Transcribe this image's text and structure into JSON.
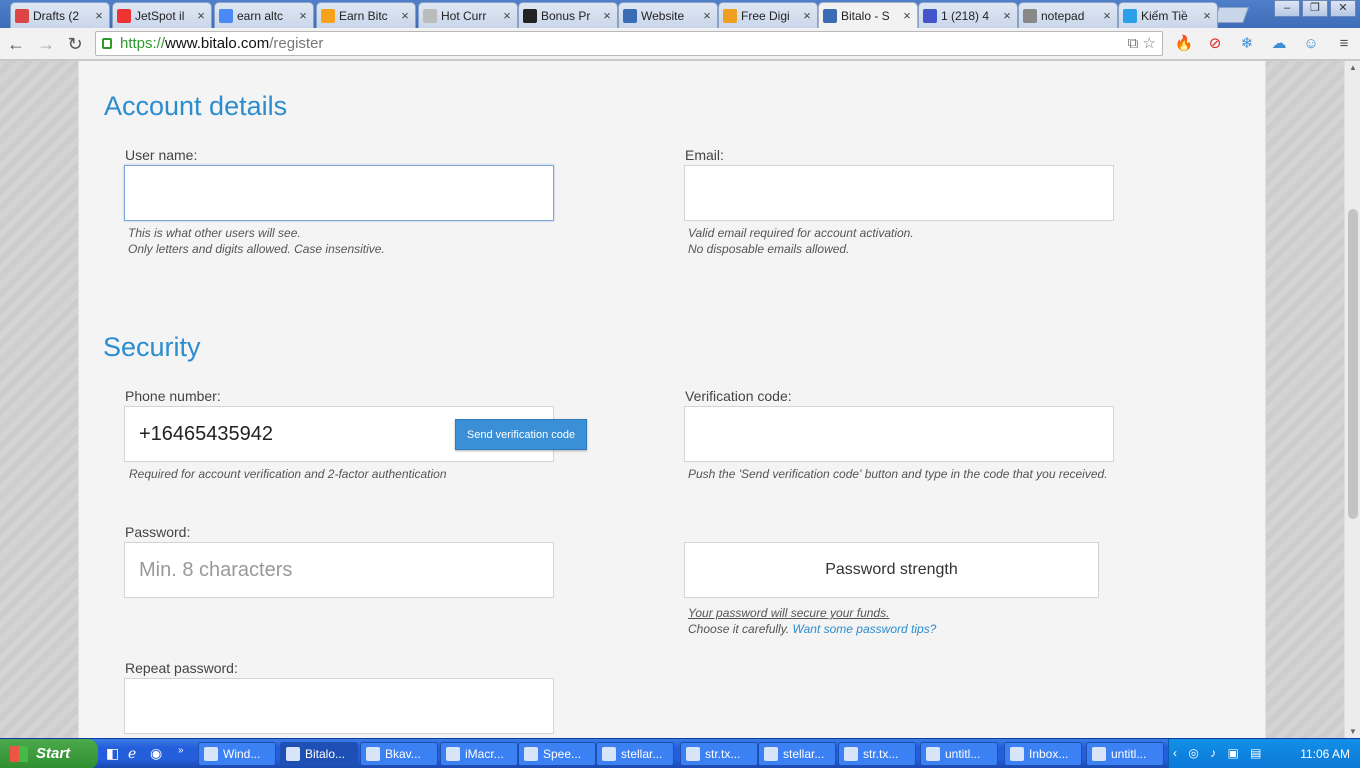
{
  "browser": {
    "tabs": [
      {
        "title": "Drafts (2",
        "icon": "gmail-icon",
        "color": "#d44"
      },
      {
        "title": "JetSpot il",
        "icon": "jetspot-icon",
        "color": "#e33"
      },
      {
        "title": "earn altc",
        "icon": "google-icon",
        "color": "#4a8af4"
      },
      {
        "title": "Earn Bitc",
        "icon": "bitcoin-icon",
        "color": "#f7a21a"
      },
      {
        "title": "Hot Curr",
        "icon": "page-icon",
        "color": "#bbb"
      },
      {
        "title": "Bonus Pr",
        "icon": "w-icon",
        "color": "#222"
      },
      {
        "title": "Website",
        "icon": "r-icon",
        "color": "#3a6db5"
      },
      {
        "title": "Free Digi",
        "icon": "coin-icon",
        "color": "#f0a020"
      },
      {
        "title": "Bitalo - S",
        "icon": "bitalo-icon",
        "color": "#3a6db5"
      },
      {
        "title": "1 (218) 4",
        "icon": "circle-icon",
        "color": "#4455cc"
      },
      {
        "title": "notepad",
        "icon": "notepad-icon",
        "color": "#888"
      },
      {
        "title": "Kiếm Tiề",
        "icon": "skype-icon",
        "color": "#2aa0e8"
      }
    ],
    "active_tab": 8,
    "url_scheme": "https://",
    "url_host": "www.bitalo.com",
    "url_path": "/register"
  },
  "form": {
    "account_heading": "Account details",
    "username_label": "User name:",
    "username_value": "",
    "username_hint1": "This is what other users will see.",
    "username_hint2": "Only letters and digits allowed. Case insensitive.",
    "email_label": "Email:",
    "email_value": "",
    "email_hint1": "Valid email required for account activation.",
    "email_hint2": "No disposable emails allowed.",
    "security_heading": "Security",
    "phone_label": "Phone number:",
    "phone_value": "+16465435942",
    "send_code_button": "Send verification code",
    "phone_hint": "Required for account verification and 2-factor authentication",
    "verify_label": "Verification code:",
    "verify_value": "",
    "verify_hint": "Push the 'Send verification code' button and type in the code that you received.",
    "password_label": "Password:",
    "password_placeholder": "Min. 8 characters",
    "strength_text": "Password strength",
    "strength_hint1": "Your password will secure your funds.",
    "strength_hint2": "Choose it carefully.",
    "strength_link": "Want some password tips?",
    "repeat_label": "Repeat password:"
  },
  "taskbar": {
    "start_label": "Start",
    "tasks": [
      "Wind...",
      "Bitalo...",
      "Bkav...",
      "iMacr...",
      "Spee...",
      "stellar...",
      "str.tx...",
      "stellar...",
      "str.tx...",
      "untitl...",
      "Inbox...",
      "untitl..."
    ],
    "active_task": 1,
    "clock": "11:06 AM"
  }
}
